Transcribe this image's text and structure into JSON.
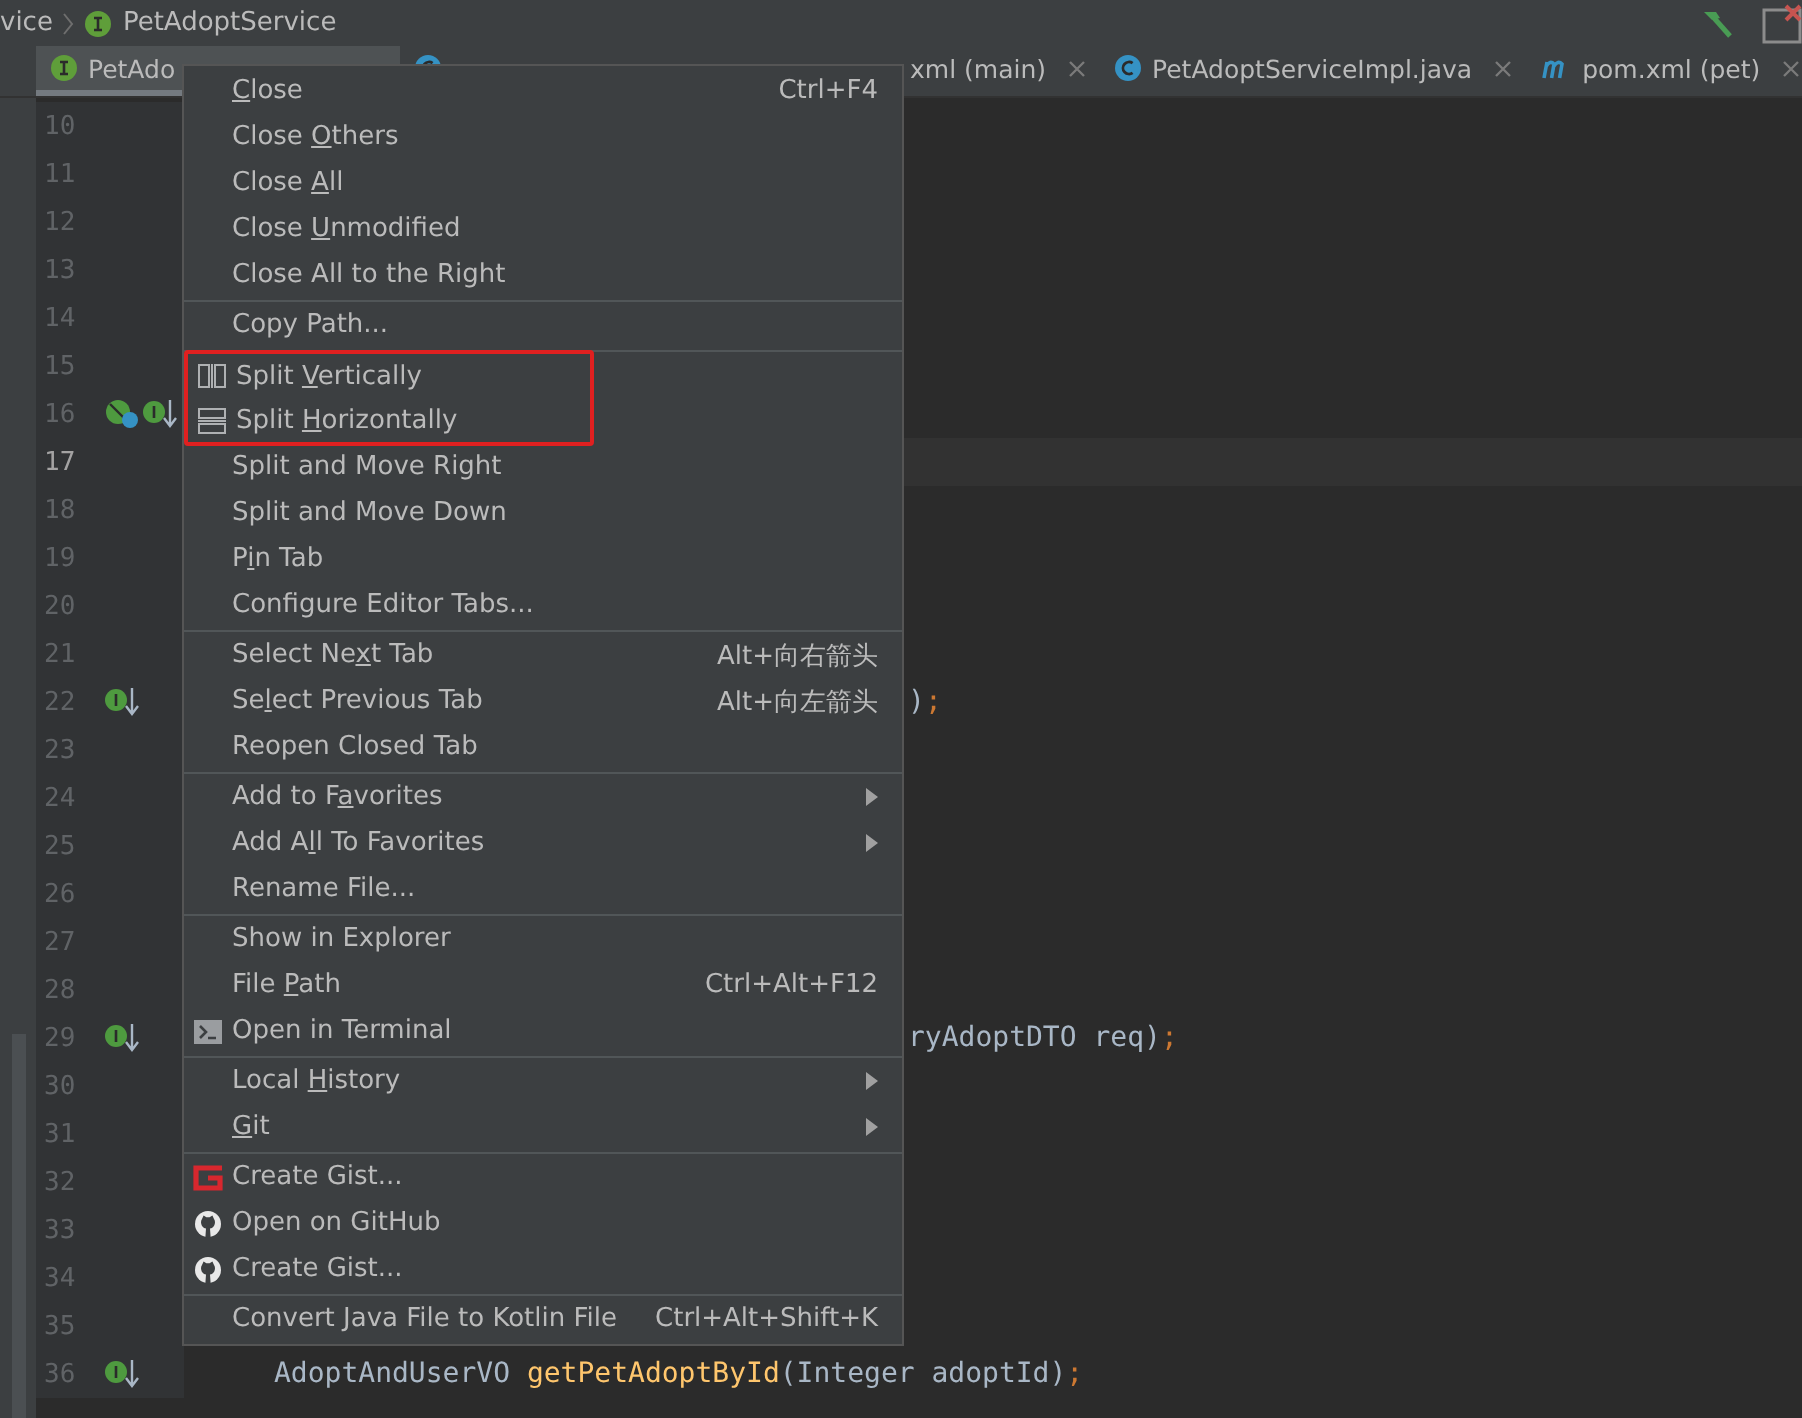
{
  "breadcrumb": [
    {
      "label": "vice"
    },
    {
      "label": "PetAdoptService"
    }
  ],
  "tabs": [
    {
      "label": "PetAdo",
      "selected": true,
      "kind": "covered"
    },
    {
      "selected": false,
      "kind": "hidden"
    },
    {
      "label": "xml (main)",
      "selected": false,
      "closable": true,
      "kind": "clipped"
    },
    {
      "label": "PetAdoptServiceImpl.java",
      "selected": false,
      "closable": true,
      "kind": "full"
    },
    {
      "label": "pom.xml (pet)",
      "selected": false,
      "closable": true,
      "kind": "full"
    }
  ],
  "editor": {
    "lines": [
      {
        "number": "10",
        "current": false
      },
      {
        "number": "11",
        "current": false
      },
      {
        "number": "12",
        "current": false
      },
      {
        "number": "13",
        "current": false
      },
      {
        "number": "14",
        "current": false
      },
      {
        "number": "15",
        "current": false
      },
      {
        "number": "16",
        "current": false
      },
      {
        "number": "17",
        "current": true
      },
      {
        "number": "18",
        "current": false
      },
      {
        "number": "19",
        "current": false
      },
      {
        "number": "20",
        "current": false
      },
      {
        "number": "21",
        "current": false
      },
      {
        "number": "22",
        "current": false,
        "kind": "clipped",
        "code": [
          {
            "text": ")",
            "kind": "plain"
          },
          {
            "text": ";",
            "kind": "punctuation"
          }
        ]
      },
      {
        "number": "23",
        "current": false
      },
      {
        "number": "24",
        "current": false
      },
      {
        "number": "25",
        "current": false
      },
      {
        "number": "26",
        "current": false
      },
      {
        "number": "27",
        "current": false
      },
      {
        "number": "28",
        "current": false
      },
      {
        "number": "29",
        "current": false,
        "kind": "clipped",
        "code": [
          {
            "text": "ryAdoptDTO req)",
            "kind": "plain"
          },
          {
            "text": ";",
            "kind": "punctuation"
          }
        ]
      },
      {
        "number": "30",
        "current": false
      },
      {
        "number": "31",
        "current": false
      },
      {
        "number": "32",
        "current": false
      },
      {
        "number": "33",
        "current": false
      },
      {
        "number": "34",
        "current": false
      },
      {
        "number": "35",
        "current": false
      },
      {
        "number": "36",
        "current": false,
        "kind": "full",
        "code": [
          {
            "text": "AdoptAndUserVO ",
            "kind": "plain"
          },
          {
            "text": "getPetAdoptById",
            "kind": "method"
          },
          {
            "text": "(Integer adoptId)",
            "kind": "plain"
          },
          {
            "text": ";",
            "kind": "punctuation"
          }
        ]
      }
    ]
  },
  "context_menu": {
    "sections": [
      {
        "items": [
          {
            "mnemonic": "C",
            "label_end": "lose",
            "shortcut": "Ctrl+F4"
          },
          {
            "label_start": "Close ",
            "mnemonic": "O",
            "label_end": "thers"
          },
          {
            "label_start": "Close ",
            "mnemonic": "A",
            "label_end": "ll"
          },
          {
            "label_start": "Close ",
            "mnemonic": "U",
            "label_end": "nmodified"
          },
          {
            "label": "Close All to the Right"
          }
        ]
      },
      {
        "items": [
          {
            "label": "Copy Path..."
          }
        ]
      },
      {
        "items": [
          {
            "label_start": "Split ",
            "mnemonic": "V",
            "label_end": "ertically",
            "annotated": true
          },
          {
            "label_start": "Split ",
            "mnemonic": "H",
            "label_end": "orizontally",
            "annotated": true
          },
          {
            "label": "Split and Move Right"
          },
          {
            "label": "Split and Move Down"
          },
          {
            "label_start": "P",
            "mnemonic": "i",
            "label_end": "n Tab"
          },
          {
            "label": "Configure Editor Tabs..."
          }
        ]
      },
      {
        "items": [
          {
            "label_start": "Select Ne",
            "mnemonic": "x",
            "label_end": "t Tab",
            "shortcut": "Alt+向右箭头"
          },
          {
            "label_start": "Se",
            "mnemonic": "l",
            "label_end": "ect Previous Tab",
            "shortcut": "Alt+向左箭头"
          },
          {
            "label": "Reopen Closed Tab"
          }
        ]
      },
      {
        "items": [
          {
            "label_start": "Add to F",
            "mnemonic": "a",
            "label_end": "vorites",
            "submenu": true
          },
          {
            "label_start": "Add A",
            "mnemonic": "l",
            "label_end": "l To Favorites",
            "submenu": true
          },
          {
            "label": "Rename File..."
          }
        ]
      },
      {
        "items": [
          {
            "label": "Show in Explorer"
          },
          {
            "label_start": "File ",
            "mnemonic": "P",
            "label_end": "ath",
            "shortcut": "Ctrl+Alt+F12"
          },
          {
            "label": "Open in Terminal"
          }
        ]
      },
      {
        "items": [
          {
            "label_start": "Local ",
            "mnemonic": "H",
            "label_end": "istory",
            "submenu": true
          },
          {
            "mnemonic": "G",
            "label_end": "it",
            "submenu": true
          }
        ]
      },
      {
        "items": [
          {
            "label": "Create Gist..."
          },
          {
            "label": "Open on GitHub"
          },
          {
            "label": "Create Gist..."
          }
        ]
      },
      {
        "items": [
          {
            "label": "Convert Java File to Kotlin File",
            "shortcut": "Ctrl+Alt+Shift+K"
          }
        ]
      }
    ]
  }
}
